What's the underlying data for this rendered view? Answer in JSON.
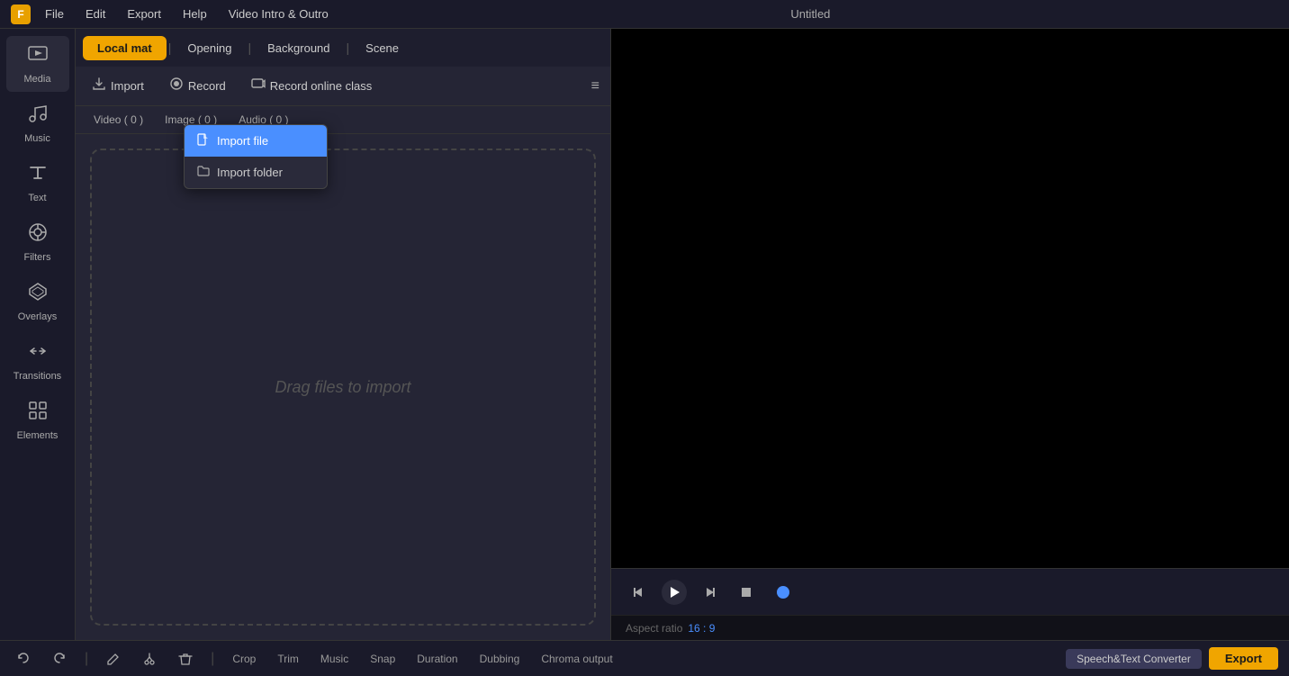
{
  "titleBar": {
    "appName": "Untitled",
    "menuItems": [
      "File",
      "Edit",
      "Export",
      "Help",
      "Video Intro & Outro"
    ]
  },
  "sidebar": {
    "items": [
      {
        "id": "media",
        "label": "Media",
        "icon": "▶"
      },
      {
        "id": "music",
        "label": "Music",
        "icon": "♪"
      },
      {
        "id": "text",
        "label": "Text",
        "icon": "T"
      },
      {
        "id": "filters",
        "label": "Filters",
        "icon": "⊕"
      },
      {
        "id": "overlays",
        "label": "Overlays",
        "icon": "◈"
      },
      {
        "id": "transitions",
        "label": "Transitions",
        "icon": "⇄"
      },
      {
        "id": "elements",
        "label": "Elements",
        "icon": "▦"
      }
    ]
  },
  "tabs": [
    {
      "id": "local-mat",
      "label": "Local mat",
      "active": true
    },
    {
      "id": "opening",
      "label": "Opening"
    },
    {
      "id": "background",
      "label": "Background"
    },
    {
      "id": "scene",
      "label": "Scene"
    }
  ],
  "toolbar": {
    "importLabel": "Import",
    "recordLabel": "Record",
    "recordOnlineLabel": "Record online class",
    "listIcon": "≡"
  },
  "filterTabs": [
    {
      "id": "video",
      "label": "Video ( 0 )"
    },
    {
      "id": "image",
      "label": "Image ( 0 )"
    },
    {
      "id": "audio",
      "label": "Audio ( 0 )"
    }
  ],
  "dropZone": {
    "text": "Drag files to import"
  },
  "importDropdown": {
    "items": [
      {
        "id": "import-file",
        "label": "Import file",
        "icon": "📄",
        "selected": true
      },
      {
        "id": "import-folder",
        "label": "Import folder",
        "icon": "📁",
        "selected": false
      }
    ]
  },
  "playback": {
    "aspectRatioLabel": "Aspect ratio",
    "aspectRatioValue": "16 : 9"
  },
  "bottomBar": {
    "tools": [
      {
        "id": "undo",
        "label": "",
        "icon": "↩"
      },
      {
        "id": "redo",
        "label": "",
        "icon": "↪"
      },
      {
        "id": "pen",
        "label": "",
        "icon": "✏"
      },
      {
        "id": "cut",
        "label": "",
        "icon": "✂"
      },
      {
        "id": "delete",
        "label": "",
        "icon": "🗑"
      },
      {
        "id": "crop",
        "label": "Crop"
      },
      {
        "id": "trim",
        "label": "Trim"
      },
      {
        "id": "music-tool",
        "label": "Music"
      },
      {
        "id": "snap",
        "label": "Snap"
      },
      {
        "id": "duration",
        "label": "Duration"
      },
      {
        "id": "dubbing",
        "label": "Dubbing"
      },
      {
        "id": "chroma",
        "label": "Chroma output"
      }
    ],
    "speechBtn": "Speech&Text Converter",
    "exportBtn": "Export"
  }
}
